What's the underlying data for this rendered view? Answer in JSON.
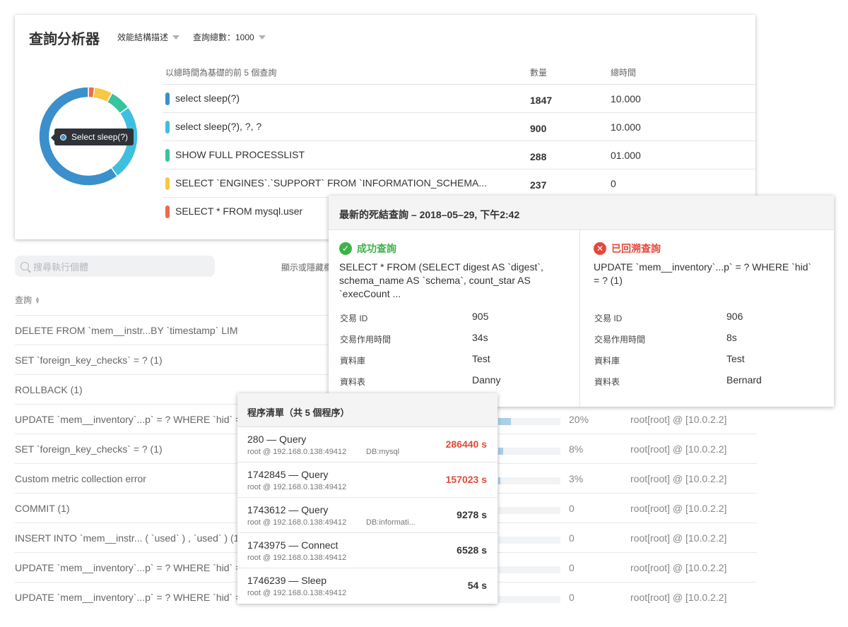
{
  "analyzer": {
    "title": "查詢分析器",
    "filter_mode": "效能結構描述",
    "filter_count": "查詢總數：1000",
    "tooltip": "Select sleep(?)",
    "table_heading": "以總時間為基礎的前 5 個查詢",
    "col_count": "數量",
    "col_total_time": "總時間",
    "rows": [
      {
        "name": "select sleep(?)",
        "count": "1847",
        "total_time": "10.000",
        "color": "#3b8fcc"
      },
      {
        "name": "select sleep(?), ?, ?",
        "count": "900",
        "total_time": "10.000",
        "color": "#3fbfe0"
      },
      {
        "name": "SHOW FULL PROCESSLIST",
        "count": "288",
        "total_time": "01.000",
        "color": "#35c49c"
      },
      {
        "name": "SELECT `ENGINES`.`SUPPORT` FROM `INFORMATION_SCHEMA...",
        "count": "237",
        "total_time": "0",
        "color": "#f7c844"
      },
      {
        "name": "SELECT * FROM mysql.user",
        "count": "",
        "total_time": "",
        "color": "#f06a45"
      }
    ],
    "donut_share": [
      {
        "value": 0.6,
        "color": "#3b8fcc"
      },
      {
        "value": 0.25,
        "color": "#3fbfe0"
      },
      {
        "value": 0.07,
        "color": "#35c49c"
      },
      {
        "value": 0.06,
        "color": "#f7c844"
      },
      {
        "value": 0.02,
        "color": "#f06a45"
      }
    ]
  },
  "list": {
    "search_placeholder": "搜尋執行個體",
    "show_hide": "顯示或隱藏欄",
    "col_query": "查詢",
    "rows": [
      {
        "query": "DELETE FROM `mem__instr...BY `timestamp` LIMIT ? (1)",
        "pct": "",
        "fill": 0,
        "user": ""
      },
      {
        "query": "SET `foreign_key_checks` = ? (1)",
        "pct": "",
        "fill": 0,
        "user": ""
      },
      {
        "query": "ROLLBACK (1)",
        "pct": "",
        "fill": 0,
        "user": ""
      },
      {
        "query": "UPDATE `mem__inventory`...p` = ? WHERE `hid` = ? (1)",
        "pct": "20%",
        "fill": 0.2,
        "user": "root[root] @ [10.0.2.2]"
      },
      {
        "query": "SET `foreign_key_checks` = ? (1)",
        "pct": "8%",
        "fill": 0.08,
        "user": "root[root] @ [10.0.2.2]"
      },
      {
        "query": "Custom metric collection error",
        "pct": "3%",
        "fill": 0.03,
        "user": "root[root] @ [10.0.2.2]"
      },
      {
        "query": "COMMIT (1)",
        "pct": "0",
        "fill": 0,
        "user": "root[root] @ [10.0.2.2]"
      },
      {
        "query": "INSERT INTO `mem__instr... ( `used` ) , `used` ) (1)",
        "pct": "0",
        "fill": 0,
        "user": "root[root] @ [10.0.2.2]"
      },
      {
        "query": "UPDATE `mem__inventory`...p` = ? WHERE `hid` = ? (1)",
        "pct": "0",
        "fill": 0,
        "user": "root[root] @ [10.0.2.2]"
      },
      {
        "query": "UPDATE `mem__inventory`...p` = ? WHERE `hid` = ? (1)",
        "pct": "0",
        "fill": 0,
        "user": "root[root] @ [10.0.2.2]"
      }
    ]
  },
  "deadlock": {
    "title": "最新的死結查詢 – 2018–05–29, 下午2:42",
    "success": {
      "label": "成功查詢",
      "color": "#3cb34a",
      "sql": "SELECT * FROM (SELECT digest AS `digest`, schema_name AS `schema`, count_star AS `execCount ...",
      "fields": [
        {
          "key": "交易 ID",
          "value": "905"
        },
        {
          "key": "交易作用時間",
          "value": "34s"
        },
        {
          "key": "資料庫",
          "value": "Test"
        },
        {
          "key": "資料表",
          "value": "Danny"
        }
      ]
    },
    "rolled_back": {
      "label": "已回溯查詢",
      "color": "#e5483a",
      "sql": "UPDATE `mem__inventory`...p` = ? WHERE `hid` = ? (1)",
      "fields": [
        {
          "key": "交易 ID",
          "value": "906"
        },
        {
          "key": "交易作用時間",
          "value": "8s"
        },
        {
          "key": "資料庫",
          "value": "Test"
        },
        {
          "key": "資料表",
          "value": "Bernard"
        }
      ]
    }
  },
  "processes": {
    "title": "程序清單（共 5 個程序）",
    "items": [
      {
        "title": "280 — Query",
        "host": "root @ 192.168.0.138:49412",
        "db": "DB:mysql",
        "seconds": "286440 s",
        "alert": true
      },
      {
        "title": "1742845 — Query",
        "host": "root @ 192.168.0.138:49412",
        "db": "",
        "seconds": "157023 s",
        "alert": true
      },
      {
        "title": "1743612 — Query",
        "host": "root @ 192.168.0.138:49412",
        "db": "DB:informati...",
        "seconds": "9278 s",
        "alert": false
      },
      {
        "title": "1743975 — Connect",
        "host": "root @ 192.168.0.138:49412",
        "db": "",
        "seconds": "6528 s",
        "alert": false
      },
      {
        "title": "1746239 — Sleep",
        "host": "root @ 192.168.0.138:49412",
        "db": "",
        "seconds": "54 s",
        "alert": false
      }
    ]
  }
}
